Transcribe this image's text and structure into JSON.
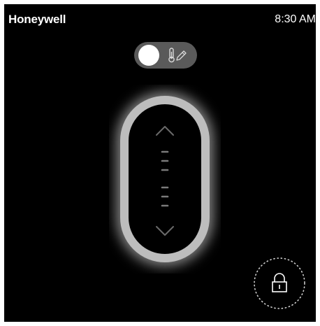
{
  "header": {
    "brand": "Honeywell",
    "time": "8:30 AM"
  },
  "mode_toggle": {
    "state": "off",
    "icon": "thermometer-edit-icon"
  },
  "setpoint_control": {
    "up_icon": "chevron-up-icon",
    "down_icon": "chevron-down-icon",
    "handle_icon": "grip-lines-icon",
    "ring_color": "#bdbdbd",
    "glow_color": "#ffffff"
  },
  "lock": {
    "icon": "lock-icon",
    "state": "locked"
  },
  "colors": {
    "background": "#000000",
    "text": "#ffffff",
    "toggle_track": "#5a5a5a"
  }
}
